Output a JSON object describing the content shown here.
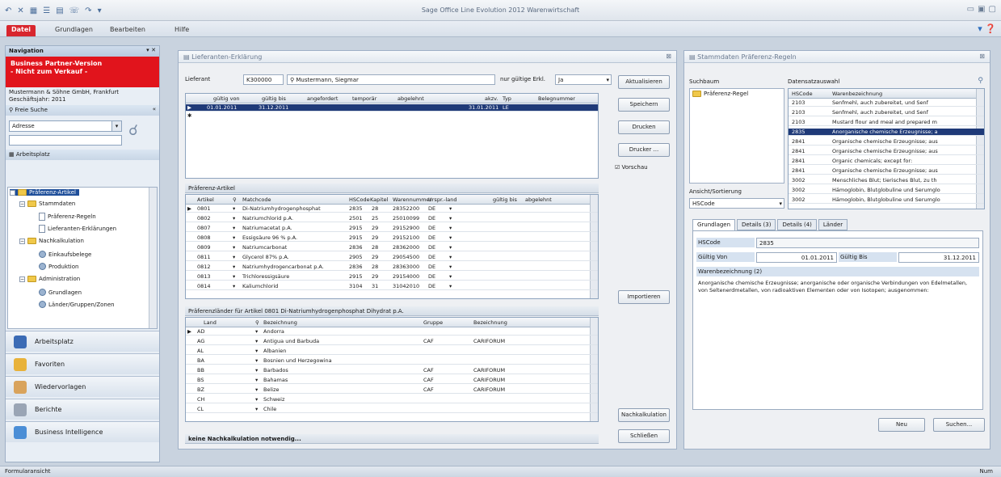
{
  "window": {
    "title": "Sage Office Line Evolution 2012 Warenwirtschaft"
  },
  "ribbon": {
    "tabs": [
      "Datei",
      "Grundlagen",
      "Bearbeiten",
      "Hilfe"
    ]
  },
  "nav": {
    "title": "Navigation",
    "notice": [
      "Business Partner-Version",
      "- Nicht zum Verkauf -"
    ],
    "company": "Mustermann & Söhne GmbH, Frankfurt",
    "fiscal_year": "Geschäftsjahr: 2011",
    "freie_suche": "Freie Suche",
    "search_combo": "Adresse",
    "workspace": "Arbeitsplatz",
    "tree": [
      "Präferenz-Artikel",
      "Stammdaten",
      "Präferenz-Regeln",
      "Lieferanten-Erklärungen",
      "Nachkalkulation",
      "Einkaufsbelege",
      "Produktion",
      "Administration",
      "Grundlagen",
      "Länder/Gruppen/Zonen"
    ],
    "buttons": [
      "Arbeitsplatz",
      "Favoriten",
      "Wiedervorlagen",
      "Berichte",
      "Business Intelligence"
    ]
  },
  "lieferanten": {
    "title": "Lieferanten-Erklärung",
    "lieferant_label": "Lieferant",
    "lieferant_nr": "K300000",
    "lieferant_name": "Mustermann, Siegmar",
    "nur_gueltige_label": "nur gültige Erkl.",
    "nur_gueltige_value": "Ja",
    "columns": [
      "gültig von",
      "gültig bis",
      "angefordert",
      "temporär",
      "abgelehnt",
      "akzv.",
      "Typ",
      "Belegnummer"
    ],
    "row": {
      "von": "01.01.2011",
      "bis": "31.12.2011",
      "akzv": "31.01.2011",
      "typ": "LE"
    },
    "buttons": [
      "Aktualisieren",
      "Speichern",
      "Drucken",
      "Drucker ...",
      "Vorschau",
      "Importieren",
      "Nachkalkulation",
      "Schließen"
    ],
    "artikel_section": "Präferenz-Artikel",
    "artikel_columns": [
      "Artikel",
      "Matchcode",
      "HSCode",
      "Kapitel",
      "Warennummer",
      "Urspr.-land",
      "gültig bis",
      "abgelehnt"
    ],
    "artikel_rows": [
      [
        "0801",
        "Di-Natriumhydrogenphosphat",
        "2835",
        "28",
        "28352200",
        "DE"
      ],
      [
        "0802",
        "Natriumchlorid p.A.",
        "2501",
        "25",
        "25010099",
        "DE"
      ],
      [
        "0807",
        "Natriumacetat p.A.",
        "2915",
        "29",
        "29152900",
        "DE"
      ],
      [
        "0808",
        "Essigsäure 96 % p.A.",
        "2915",
        "29",
        "29152100",
        "DE"
      ],
      [
        "0809",
        "Natriumcarbonat",
        "2836",
        "28",
        "28362000",
        "DE"
      ],
      [
        "0811",
        "Glycerol 87% p.A.",
        "2905",
        "29",
        "29054500",
        "DE"
      ],
      [
        "0812",
        "Natriumhydrogencarbonat p.A.",
        "2836",
        "28",
        "28363000",
        "DE"
      ],
      [
        "0813",
        "Trichloressigsäure",
        "2915",
        "29",
        "29154000",
        "DE"
      ],
      [
        "0814",
        "Kaliumchlorid",
        "3104",
        "31",
        "31042010",
        "DE"
      ]
    ],
    "laender_section": "Präferenzländer für Artikel 0801 Di-Natriumhydrogenphosphat Dihydrat p.A.",
    "laender_columns": [
      "Land",
      "Bezeichnung",
      "Gruppe",
      "Bezeichnung"
    ],
    "laender_rows": [
      [
        "AD",
        "Andorra",
        "",
        ""
      ],
      [
        "AG",
        "Antigua und Barbuda",
        "CAF",
        "CARIFORUM"
      ],
      [
        "AL",
        "Albanien",
        "",
        ""
      ],
      [
        "BA",
        "Bosnien und Herzegowina",
        "",
        ""
      ],
      [
        "BB",
        "Barbados",
        "CAF",
        "CARIFORUM"
      ],
      [
        "BS",
        "Bahamas",
        "CAF",
        "CARIFORUM"
      ],
      [
        "BZ",
        "Belize",
        "CAF",
        "CARIFORUM"
      ],
      [
        "CH",
        "Schweiz",
        "",
        ""
      ],
      [
        "CL",
        "Chile",
        "",
        ""
      ]
    ],
    "status_msg": "keine Nachkalkulation notwendig..."
  },
  "regeln": {
    "title": "Stammdaten Präferenz-Regeln",
    "suchbaum_label": "Suchbaum",
    "suchbaum_item": "Präferenz-Regel",
    "datensatz_label": "Datensatzauswahl",
    "ds_columns": [
      "HSCode",
      "Warenbezeichnung"
    ],
    "ds_rows": [
      [
        "2103",
        "Senfmehl, auch zubereitet, und Senf"
      ],
      [
        "2103",
        "Senfmehl, auch zubereitet, und Senf"
      ],
      [
        "2103",
        "Mustard flour and meal and prepared m"
      ],
      [
        "2835",
        "Anorganische chemische Erzeugnisse; a"
      ],
      [
        "2841",
        "Organische chemische Erzeugnisse; aus"
      ],
      [
        "2841",
        "Organische chemische Erzeugnisse; aus"
      ],
      [
        "2841",
        "Organic chemicals; except for:"
      ],
      [
        "2841",
        "Organische chemische Erzeugnisse; aus"
      ],
      [
        "3002",
        "Menschliches Blut; tierisches Blut, zu th"
      ],
      [
        "3002",
        "Hämoglobin, Blutglobuline und Serumglo"
      ],
      [
        "3002",
        "Hämoglobin, Blutglobuline und Serumglo"
      ]
    ],
    "ansicht_label": "Ansicht/Sortierung",
    "ansicht_value": "HSCode",
    "tabs": [
      "Grundlagen",
      "Details (3)",
      "Details (4)",
      "Länder"
    ],
    "hscode_label": "HSCode",
    "hscode_value": "2835",
    "gueltig_von_label": "Gültig Von",
    "gueltig_von": "01.01.2011",
    "gueltig_bis_label": "Gültig Bis",
    "gueltig_bis": "31.12.2011",
    "warenbez_label": "Warenbezeichnung (2)",
    "warenbez_text": "Anorganische chemische Erzeugnisse; anorganische oder organische Verbindungen von Edelmetallen, von Seltenerdmetallen, von radioaktiven Elementen oder von Isotopen; ausgenommen:",
    "buttons": [
      "Neu",
      "Suchen..."
    ]
  },
  "statusbar": {
    "left": "Formularansicht",
    "right": "Num"
  }
}
